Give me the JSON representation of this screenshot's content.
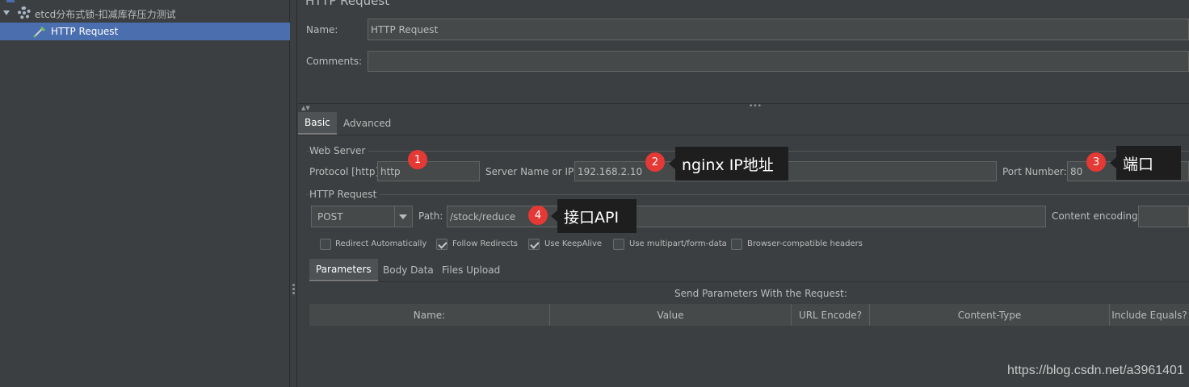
{
  "tree": {
    "test_plan_label": "etcd分布式锁-扣减库存压力测试",
    "selected_label": "HTTP Request"
  },
  "panel": {
    "title": "HTTP Request",
    "name_label": "Name:",
    "name_value": "HTTP Request",
    "comments_label": "Comments:",
    "comments_value": ""
  },
  "config_tabs": [
    {
      "label": "Basic",
      "active": true
    },
    {
      "label": "Advanced",
      "active": false
    }
  ],
  "web_server": {
    "section_label": "Web Server",
    "protocol_label": "Protocol [http]:",
    "protocol_value": "http",
    "server_label": "Server Name or IP:",
    "server_value": "192.168.2.10",
    "port_label": "Port Number:",
    "port_value": "80"
  },
  "http_request": {
    "section_label": "HTTP Request",
    "method_value": "POST",
    "path_label": "Path:",
    "path_value": "/stock/reduce",
    "encoding_label": "Content encoding:",
    "encoding_value": ""
  },
  "options": [
    {
      "label": "Redirect Automatically",
      "checked": false
    },
    {
      "label": "Follow Redirects",
      "checked": true
    },
    {
      "label": "Use KeepAlive",
      "checked": true
    },
    {
      "label": "Use multipart/form-data",
      "checked": false
    },
    {
      "label": "Browser-compatible headers",
      "checked": false
    }
  ],
  "param_tabs": [
    {
      "label": "Parameters",
      "active": true
    },
    {
      "label": "Body Data",
      "active": false
    },
    {
      "label": "Files Upload",
      "active": false
    }
  ],
  "params_table": {
    "caption": "Send Parameters With the Request:",
    "headers": [
      "Name:",
      "Value",
      "URL Encode?",
      "Content-Type",
      "Include Equals?"
    ]
  },
  "annotations": [
    {
      "number": "1",
      "text": ""
    },
    {
      "number": "2",
      "text": "nginx IP地址"
    },
    {
      "number": "3",
      "text": "端口"
    },
    {
      "number": "4",
      "text": "接口API"
    }
  ],
  "watermark": "https://blog.csdn.net/a3961401",
  "colors": {
    "selection": "#4b6eaf",
    "background": "#3c3f41",
    "badge": "#e53935",
    "callout": "#1e1e1e"
  }
}
